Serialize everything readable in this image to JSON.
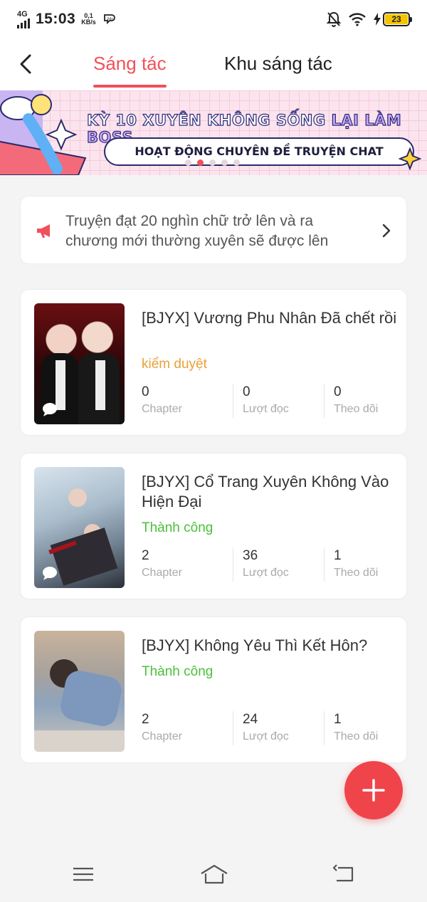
{
  "status_bar": {
    "network": "4G",
    "time": "15:03",
    "speed_value": "0,1",
    "speed_unit": "KB/s",
    "battery": "23"
  },
  "header": {
    "tabs": [
      {
        "label": "Sáng tác",
        "active": true
      },
      {
        "label": "Khu sáng tác",
        "active": false
      }
    ]
  },
  "banner": {
    "title_part1": "KỲ 10 XUYÊN KHÔNG SỐNG ",
    "title_part2": "LẠI LÀM BOSS",
    "subtitle": "HOẠT ĐỘNG CHUYÊN ĐỀ TRUYỆN CHAT",
    "active_slide": 2
  },
  "notice": {
    "text": "Truyện đạt 20 nghìn chữ trở lên và ra chương mới thường xuyên sẽ được lên"
  },
  "stories": [
    {
      "title": "[BJYX] Vương Phu Nhân Đã chết rồi",
      "status": "kiểm duyệt",
      "chapters": "0",
      "reads": "0",
      "follows": "0"
    },
    {
      "title": "[BJYX] Cổ Trang Xuyên Không Vào Hiện Đại",
      "status": "Thành công",
      "chapters": "2",
      "reads": "36",
      "follows": "1"
    },
    {
      "title": "[BJYX] Không Yêu Thì Kết Hôn?",
      "status": "Thành công",
      "chapters": "2",
      "reads": "24",
      "follows": "1"
    }
  ],
  "labels": {
    "chapter": "Chapter",
    "reads": "Lượt đọc",
    "follows": "Theo dõi"
  },
  "colors": {
    "accent": "#f0515a",
    "pending": "#e9a13a",
    "success": "#4bbf3a"
  }
}
